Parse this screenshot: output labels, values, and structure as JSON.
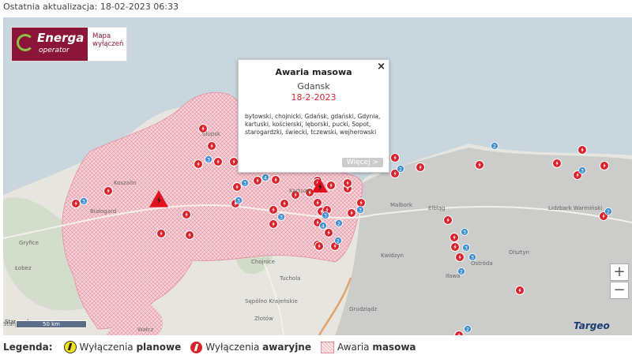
{
  "header": {
    "last_update": "Ostatnia aktualizacja: 18-02-2023 06:33"
  },
  "logo": {
    "brand": "Energa",
    "sub": "operator",
    "app_line1": "Mapa",
    "app_line2": "wyłączeń"
  },
  "popup": {
    "title": "Awaria masowa",
    "city": "Gdansk",
    "date": "18-2-2023",
    "districts": "bytowski, chojnicki, Gdańsk, gdański, Gdynia, kartuski, kościerski, lęborski, pucki, Sopot, starogardzki, świecki, tczewski, wejherowski",
    "more_label": "Więcej >",
    "close": "×"
  },
  "map": {
    "colors": {
      "mass_area": "#f6c9d0",
      "hatch": "#e8899a",
      "failure_marker": "#d9232d",
      "count_badge": "#3d8fd1",
      "planned_marker": "#f6e21c"
    },
    "place_labels": [
      "Koszalin",
      "Białogard",
      "Gryfice",
      "Łobez",
      "Chojnice",
      "Tuchola",
      "Sępólno Krajeńskie",
      "Złotów",
      "Wałcz",
      "Stargard",
      "Elbląg",
      "Malbork",
      "Olsztyn",
      "Ostróda",
      "Iława",
      "Grudziądz",
      "Lidzbark Warmiński",
      "Słupsk",
      "Kwidzyn",
      "Kartuzy"
    ],
    "badge_counts": [
      "3",
      "3",
      "3",
      "3",
      "4",
      "3",
      "3",
      "4",
      "3",
      "2",
      "2",
      "2",
      "3",
      "2",
      "3",
      "2",
      "3",
      "3",
      "2",
      "2"
    ]
  },
  "controls": {
    "zoom_in": "+",
    "zoom_out": "−",
    "scale": "50 km",
    "scale_left": "Stargard",
    "attribution": "Targeo"
  },
  "legend": {
    "label": "Legenda:",
    "planned_prefix": "Wyłączenia ",
    "planned_bold": "planowe",
    "failure_prefix": "Wyłączenia ",
    "failure_bold": "awaryjne",
    "mass_prefix": "Awaria ",
    "mass_bold": "masowa"
  }
}
